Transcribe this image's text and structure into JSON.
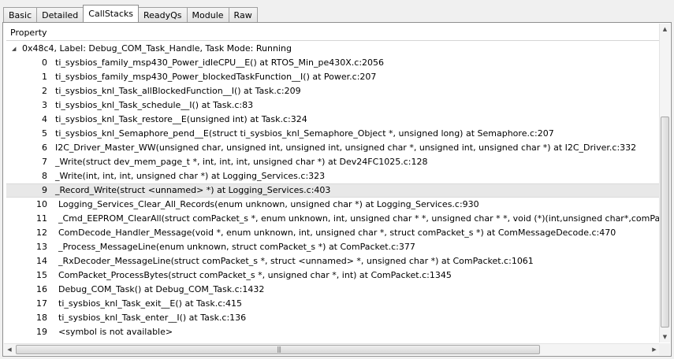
{
  "tabs": [
    {
      "label": "Basic"
    },
    {
      "label": "Detailed"
    },
    {
      "label": "CallStacks",
      "active": true
    },
    {
      "label": "ReadyQs"
    },
    {
      "label": "Module"
    },
    {
      "label": "Raw"
    }
  ],
  "table": {
    "header": "Property",
    "parent": "0x48c4,  Label: Debug_COM_Task_Handle,  Task Mode: Running",
    "rows": [
      {
        "idx": "0",
        "text": "ti_sysbios_family_msp430_Power_idleCPU__E() at RTOS_Min_pe430X.c:2056"
      },
      {
        "idx": "1",
        "text": "ti_sysbios_family_msp430_Power_blockedTaskFunction__I() at Power.c:207"
      },
      {
        "idx": "2",
        "text": "ti_sysbios_knl_Task_allBlockedFunction__I() at Task.c:209"
      },
      {
        "idx": "3",
        "text": "ti_sysbios_knl_Task_schedule__I() at Task.c:83"
      },
      {
        "idx": "4",
        "text": "ti_sysbios_knl_Task_restore__E(unsigned int) at Task.c:324"
      },
      {
        "idx": "5",
        "text": "ti_sysbios_knl_Semaphore_pend__E(struct ti_sysbios_knl_Semaphore_Object *, unsigned long) at Semaphore.c:207"
      },
      {
        "idx": "6",
        "text": "I2C_Driver_Master_WW(unsigned char, unsigned int, unsigned int, unsigned char *, unsigned int, unsigned char *) at I2C_Driver.c:332"
      },
      {
        "idx": "7",
        "text": "_Write(struct dev_mem_page_t *, int, int, int, unsigned char *) at Dev24FC1025.c:128"
      },
      {
        "idx": "8",
        "text": "_Write(int, int, int, unsigned char *) at Logging_Services.c:323"
      },
      {
        "idx": "9",
        "text": "_Record_Write(struct <unnamed> *) at Logging_Services.c:403",
        "selected": true
      },
      {
        "idx": "10",
        "text": "Logging_Services_Clear_All_Records(enum unknown, unsigned char *) at Logging_Services.c:930"
      },
      {
        "idx": "11",
        "text": "_Cmd_EEPROM_ClearAll(struct comPacket_s *, enum unknown, int, unsigned char * *, unsigned char * *, void (*)(int,unsigned char*,comPacket_s"
      },
      {
        "idx": "12",
        "text": "ComDecode_Handler_Message(void *, enum unknown, int, unsigned char *, struct comPacket_s *) at ComMessageDecode.c:470"
      },
      {
        "idx": "13",
        "text": "_Process_MessageLine(enum unknown, struct comPacket_s *) at ComPacket.c:377"
      },
      {
        "idx": "14",
        "text": "_RxDecoder_MessageLine(struct comPacket_s *, struct <unnamed> *, unsigned char *) at ComPacket.c:1061"
      },
      {
        "idx": "15",
        "text": "ComPacket_ProcessBytes(struct comPacket_s *, unsigned char *, int) at ComPacket.c:1345"
      },
      {
        "idx": "16",
        "text": "Debug_COM_Task() at Debug_COM_Task.c:1432"
      },
      {
        "idx": "17",
        "text": "ti_sysbios_knl_Task_exit__E() at Task.c:415"
      },
      {
        "idx": "18",
        "text": "ti_sysbios_knl_Task_enter__I() at Task.c:136"
      },
      {
        "idx": "19",
        "text": "<symbol is not available>"
      }
    ]
  },
  "icons": {
    "expand": "expanded-triangle-icon",
    "scroll_up": "scroll-up-icon",
    "scroll_down": "scroll-down-icon",
    "scroll_left": "scroll-left-icon",
    "scroll_right": "scroll-right-icon"
  }
}
